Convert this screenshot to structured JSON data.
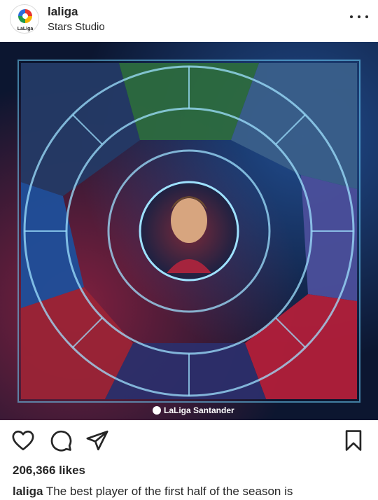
{
  "post": {
    "username": "laliga",
    "location": "Stars Studio",
    "avatar_text": "LaLiga",
    "brand_footer": "LaLiga Santander",
    "likes": "206,366 likes",
    "caption_user": "laliga",
    "caption_text": "The best player of the first half of the season is"
  },
  "icons": {
    "more": "more-options-icon",
    "like": "heart-icon",
    "comment": "comment-icon",
    "share": "send-icon",
    "save": "bookmark-icon"
  },
  "colors": {
    "text": "#262626",
    "image_bg": "#0e1b36",
    "glow_cyan": "#6fd6ff",
    "glow_red": "#e0284a"
  }
}
